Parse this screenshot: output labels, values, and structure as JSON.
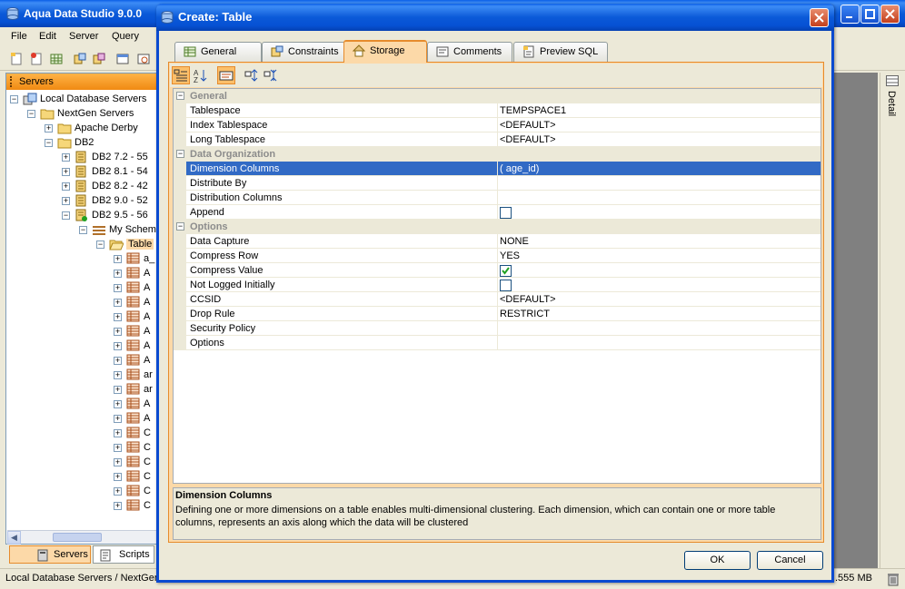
{
  "main_window": {
    "title": "Aqua Data Studio 9.0.0",
    "menu": [
      "File",
      "Edit",
      "Server",
      "Query"
    ],
    "status_path": "Local Database Servers / NextGen",
    "memory": ".555 MB",
    "detail_label": "Detail"
  },
  "servers_panel": {
    "header": "Servers",
    "tree": [
      {
        "label": "Local Database Servers"
      },
      {
        "label": "NextGen Servers"
      },
      {
        "label": "Apache Derby"
      },
      {
        "label": "DB2"
      },
      {
        "label": "DB2 7.2 - 55"
      },
      {
        "label": "DB2 8.1 - 54"
      },
      {
        "label": "DB2 8.2 - 42"
      },
      {
        "label": "DB2 9.0 - 52"
      },
      {
        "label": "DB2 9.5 - 56"
      },
      {
        "label": "My Schem"
      },
      {
        "label": "Table"
      },
      {
        "label": "a_"
      },
      {
        "label": "A"
      },
      {
        "label": "A"
      },
      {
        "label": "A"
      },
      {
        "label": "A"
      },
      {
        "label": "A"
      },
      {
        "label": "A"
      },
      {
        "label": "A"
      },
      {
        "label": "ar"
      },
      {
        "label": "ar"
      },
      {
        "label": "A"
      },
      {
        "label": "A"
      },
      {
        "label": "C"
      },
      {
        "label": "C"
      },
      {
        "label": "C"
      },
      {
        "label": "C"
      },
      {
        "label": "C"
      },
      {
        "label": "C"
      },
      {
        "label": "C"
      }
    ],
    "tabs": [
      "Servers",
      "Scripts"
    ]
  },
  "dialog": {
    "title": "Create: Table",
    "tabs": [
      "General",
      "Constraints",
      "Storage",
      "Comments",
      "Preview SQL"
    ],
    "active_tab": "Storage",
    "sections": {
      "general": "General",
      "data_organization": "Data Organization",
      "options": "Options"
    },
    "properties": {
      "tablespace": {
        "name": "Tablespace",
        "value": "TEMPSPACE1"
      },
      "index_tablespace": {
        "name": "Index Tablespace",
        "value": "<DEFAULT>"
      },
      "long_tablespace": {
        "name": "Long Tablespace",
        "value": "<DEFAULT>"
      },
      "dimension_columns": {
        "name": "Dimension Columns",
        "value": "( age_id)"
      },
      "distribute_by": {
        "name": "Distribute By",
        "value": ""
      },
      "distribution_columns": {
        "name": "Distribution Columns",
        "value": ""
      },
      "append": {
        "name": "Append",
        "checked": false
      },
      "data_capture": {
        "name": "Data Capture",
        "value": "NONE"
      },
      "compress_row": {
        "name": "Compress Row",
        "value": "YES"
      },
      "compress_value": {
        "name": "Compress Value",
        "checked": true
      },
      "not_logged_initially": {
        "name": "Not Logged Initially",
        "checked": false
      },
      "ccsid": {
        "name": "CCSID",
        "value": "<DEFAULT>"
      },
      "drop_rule": {
        "name": "Drop Rule",
        "value": "RESTRICT"
      },
      "security_policy": {
        "name": "Security Policy",
        "value": ""
      },
      "options": {
        "name": "Options",
        "value": ""
      }
    },
    "description": {
      "title": "Dimension Columns",
      "text": "Defining one or more dimensions on a table enables multi-dimensional clustering. Each dimension, which can contain one or more table columns, represents an axis along which the data will be clustered"
    },
    "buttons": {
      "ok": "OK",
      "cancel": "Cancel"
    }
  },
  "colors": {
    "selection": "#316ac5",
    "accent_orange": "#e68b2c",
    "titlebar_blue": "#0a5fe6"
  }
}
